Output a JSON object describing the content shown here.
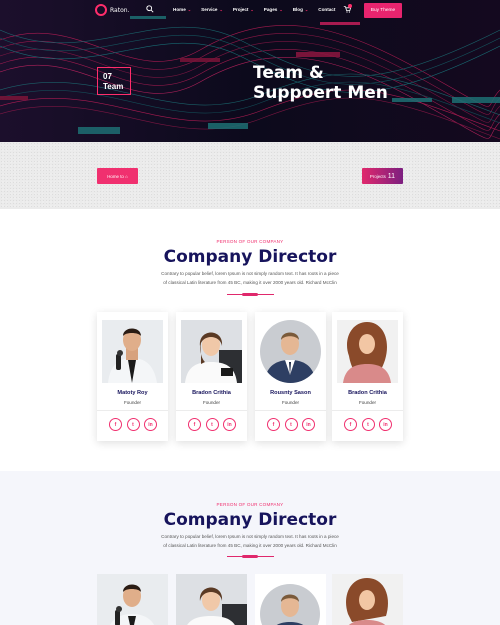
{
  "nav": {
    "logo_text": "Raton.",
    "menu": [
      {
        "label": "Home",
        "chevron": "⌄"
      },
      {
        "label": "Service",
        "chevron": "⌄"
      },
      {
        "label": "Project",
        "chevron": "⌄"
      },
      {
        "label": "Pages",
        "chevron": "⌄"
      },
      {
        "label": "Blog",
        "chevron": "⌄"
      },
      {
        "label": "Contact",
        "chevron": ""
      }
    ],
    "buy_label": "Buy Theme",
    "icons": {
      "search": "search-icon",
      "cart": "cart-icon"
    }
  },
  "hero": {
    "badge_number": "07",
    "badge_label": "Team",
    "title_line1": "Team &",
    "title_line2": "Suppoert Men"
  },
  "breadcrumb": {
    "home_label": "Home to ⌂",
    "projects_label": "Projects",
    "projects_count": "11"
  },
  "team_section_1": {
    "kicker": "PERSON OF OUR COMPANY",
    "title": "Company Director",
    "description_line1": "Contrary to popular belief, lorem Ipsum is not simply random text. It has roots in a piece",
    "description_line2": "of classical Latin literature from 45 BC, making it over 2000 years old. Richard McClin",
    "members": [
      {
        "name": "Matoty Roy",
        "role": "Founder"
      },
      {
        "name": "Bradon Crithia",
        "role": "Founder"
      },
      {
        "name": "Rousnty Sason",
        "role": "Founder"
      },
      {
        "name": "Bradon Crithia",
        "role": "Founder"
      }
    ],
    "social": {
      "facebook": "f",
      "twitter": "t",
      "linkedin": "in"
    }
  },
  "team_section_2": {
    "kicker": "PERSON OF OUR COMPANY",
    "title": "Company Director",
    "description_line1": "Contrary to popular belief, lorem Ipsum is not simply random text. It has roots in a piece",
    "description_line2": "of classical Latin literature from 45 BC, making it over 2000 years old. Richard McClin"
  },
  "colors": {
    "accent": "#f0306f",
    "navy": "#17145c",
    "hero_bg": "#0b0716"
  }
}
